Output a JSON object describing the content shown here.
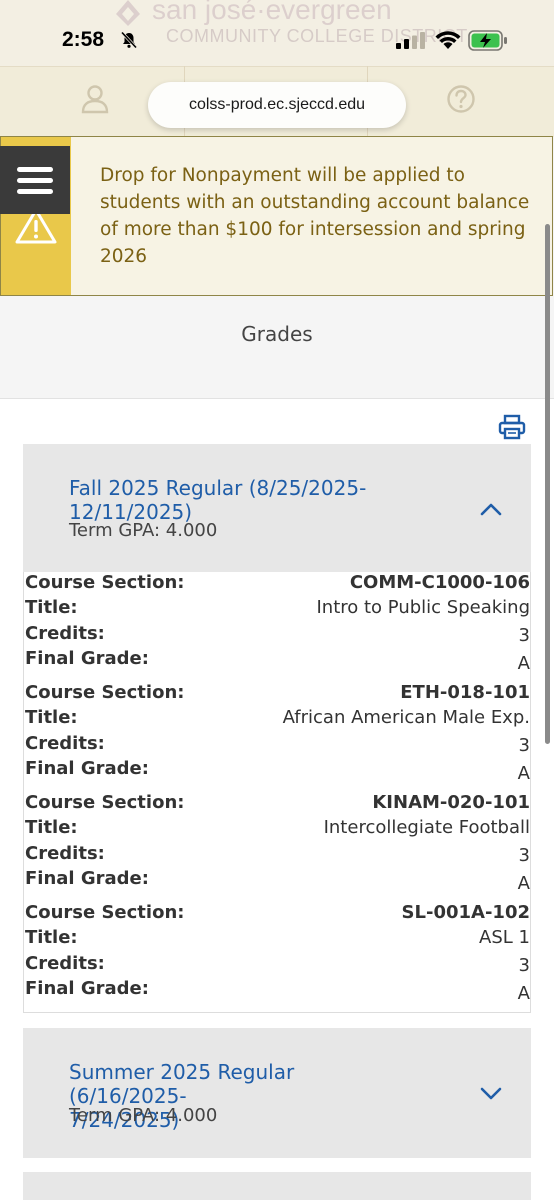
{
  "status_bar": {
    "time": "2:58"
  },
  "logo_watermark": {
    "line1": "san josé·evergreen",
    "line2": "COMMUNITY COLLEGE DISTRICT"
  },
  "browser": {
    "url": "colss-prod.ec.sjeccd.edu"
  },
  "alert": {
    "message": "Drop for Nonpayment will be applied to students with an outstanding account balance of more than $100 for intersession and spring 2026"
  },
  "page": {
    "title": "Grades"
  },
  "labels": {
    "course_section": "Course Section:",
    "title": "Title:",
    "credits": "Credits:",
    "final_grade": "Final Grade:"
  },
  "terms": [
    {
      "name": "Fall 2025 Regular (8/25/2025-12/11/2025)",
      "name_line1": "Fall 2025 Regular (8/25/2025-",
      "name_line2": "12/11/2025)",
      "gpa": "Term GPA: 4.000",
      "expanded": true,
      "courses": [
        {
          "section": "COMM-C1000-106",
          "title": "Intro to Public Speaking",
          "credits": "3",
          "grade": "A"
        },
        {
          "section": "ETH-018-101",
          "title": "African American Male Exp.",
          "credits": "3",
          "grade": "A"
        },
        {
          "section": "KINAM-020-101",
          "title": "Intercollegiate Football",
          "credits": "3",
          "grade": "A"
        },
        {
          "section": "SL-001A-102",
          "title": "ASL 1",
          "credits": "3",
          "grade": "A"
        }
      ]
    },
    {
      "name": "Summer 2025 Regular (6/16/2025-7/24/2025)",
      "name_line1": "Summer 2025 Regular (6/16/2025-",
      "name_line2": "7/24/2025)",
      "gpa": "Term GPA: 4.000",
      "expanded": false
    }
  ],
  "icons": {
    "menu": "hamburger-menu-icon",
    "warning": "warning-icon",
    "print": "print-icon",
    "collapse": "chevron-up-icon",
    "expand": "chevron-down-icon",
    "profile": "user-icon",
    "help": "help-icon"
  },
  "colors": {
    "link": "#1f5da8",
    "alert_text": "#7b6114",
    "alert_strip": "#e9c84a",
    "panel": "#e7e7e7"
  }
}
